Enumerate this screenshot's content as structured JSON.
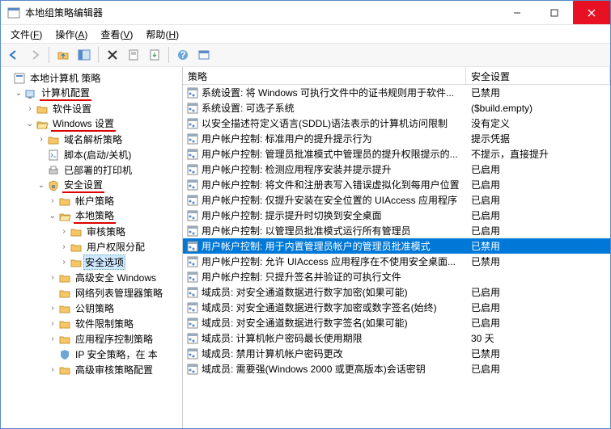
{
  "window": {
    "title": "本地组策略编辑器"
  },
  "menus": [
    {
      "label": "文件",
      "key": "F"
    },
    {
      "label": "操作",
      "key": "A"
    },
    {
      "label": "查看",
      "key": "V"
    },
    {
      "label": "帮助",
      "key": "H"
    }
  ],
  "tree": {
    "root": "本地计算机 策略",
    "computer_config": "计算机配置",
    "software_settings": "软件设置",
    "windows_settings": "Windows 设置",
    "name_resolution": "域名解析策略",
    "scripts": "脚本(启动/关机)",
    "deployed_printers": "已部署的打印机",
    "security_settings": "安全设置",
    "account_policies": "帐户策略",
    "local_policies": "本地策略",
    "audit_policy": "审核策略",
    "user_rights": "用户权限分配",
    "security_options": "安全选项",
    "advanced_security": "高级安全 Windows",
    "network_list": "网络列表管理器策略",
    "public_key": "公钥策略",
    "software_restriction": "软件限制策略",
    "app_control": "应用程序控制策略",
    "ip_security": "IP 安全策略，在 本",
    "advanced_audit": "高级审核策略配置"
  },
  "columns": {
    "policy": "策略",
    "setting": "安全设置"
  },
  "rows": [
    {
      "policy": "系统设置: 将 Windows 可执行文件中的证书规则用于软件...",
      "setting": "已禁用"
    },
    {
      "policy": "系统设置: 可选子系统",
      "setting": "($build.empty)"
    },
    {
      "policy": "以安全描述符定义语言(SDDL)语法表示的计算机访问限制",
      "setting": "没有定义"
    },
    {
      "policy": "用户帐户控制: 标准用户的提升提示行为",
      "setting": "提示凭据"
    },
    {
      "policy": "用户帐户控制: 管理员批准模式中管理员的提升权限提示的...",
      "setting": "不提示，直接提升"
    },
    {
      "policy": "用户帐户控制: 检测应用程序安装并提示提升",
      "setting": "已启用"
    },
    {
      "policy": "用户帐户控制: 将文件和注册表写入错误虚拟化到每用户位置",
      "setting": "已启用"
    },
    {
      "policy": "用户帐户控制: 仅提升安装在安全位置的 UIAccess 应用程序",
      "setting": "已启用"
    },
    {
      "policy": "用户帐户控制: 提示提升时切换到安全桌面",
      "setting": "已启用"
    },
    {
      "policy": "用户帐户控制: 以管理员批准模式运行所有管理员",
      "setting": "已启用"
    },
    {
      "policy": "用户帐户控制: 用于内置管理员帐户的管理员批准模式",
      "setting": "已禁用",
      "selected": true
    },
    {
      "policy": "用户帐户控制: 允许 UIAccess 应用程序在不使用安全桌面...",
      "setting": "已禁用"
    },
    {
      "policy": "用户帐户控制: 只提升签名并验证的可执行文件",
      "setting": ""
    },
    {
      "policy": "域成员: 对安全通道数据进行数字加密(如果可能)",
      "setting": "已启用"
    },
    {
      "policy": "域成员: 对安全通道数据进行数字加密或数字签名(始终)",
      "setting": "已启用"
    },
    {
      "policy": "域成员: 对安全通道数据进行数字签名(如果可能)",
      "setting": "已启用"
    },
    {
      "policy": "域成员: 计算机帐户密码最长使用期限",
      "setting": "30 天"
    },
    {
      "policy": "域成员: 禁用计算机帐户密码更改",
      "setting": "已禁用"
    },
    {
      "policy": "域成员: 需要强(Windows 2000 或更高版本)会话密钥",
      "setting": "已启用"
    }
  ]
}
